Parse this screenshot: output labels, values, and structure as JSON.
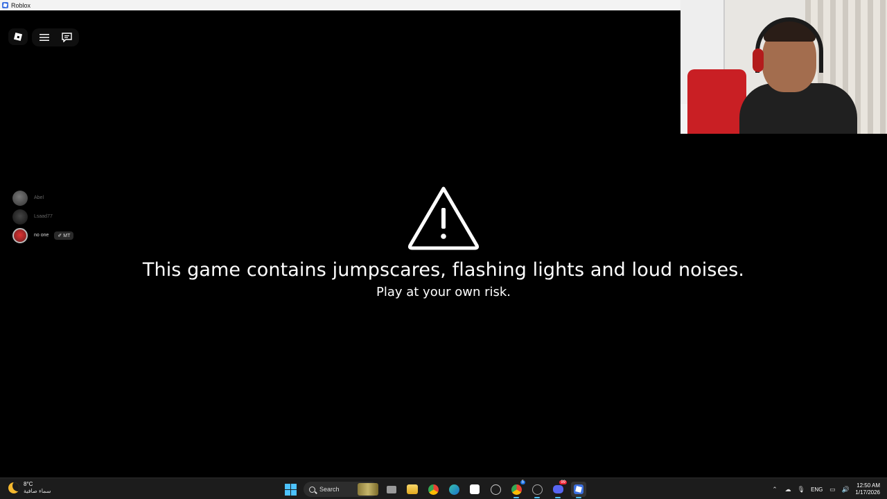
{
  "window": {
    "title": "Roblox"
  },
  "players": [
    {
      "name": "Abel"
    },
    {
      "name": "Lsaad77"
    },
    {
      "name": "no one",
      "badge": "MT"
    }
  ],
  "warning": {
    "title": "This game contains jumpscares, flashing lights and loud noises.",
    "subtitle": "Play at your own risk."
  },
  "taskbar": {
    "weather": {
      "temp": "8°C",
      "condition": "سماء صافية"
    },
    "search_label": "Search",
    "apps": [
      "widgets",
      "task-view",
      "file-explorer",
      "chrome",
      "edge",
      "microsoft-store",
      "chatgpt",
      "chrome-profile",
      "openai",
      "discord",
      "roblox"
    ],
    "badges": {
      "chrome-profile": "5",
      "discord": "99"
    },
    "tray": {
      "language": "ENG",
      "time": "12:50 AM",
      "date": "1/17/2026"
    }
  },
  "colors": {
    "accent": "#4cc2ff",
    "roblox_blue": "#3b6fe0",
    "warning": "#ffffff"
  }
}
